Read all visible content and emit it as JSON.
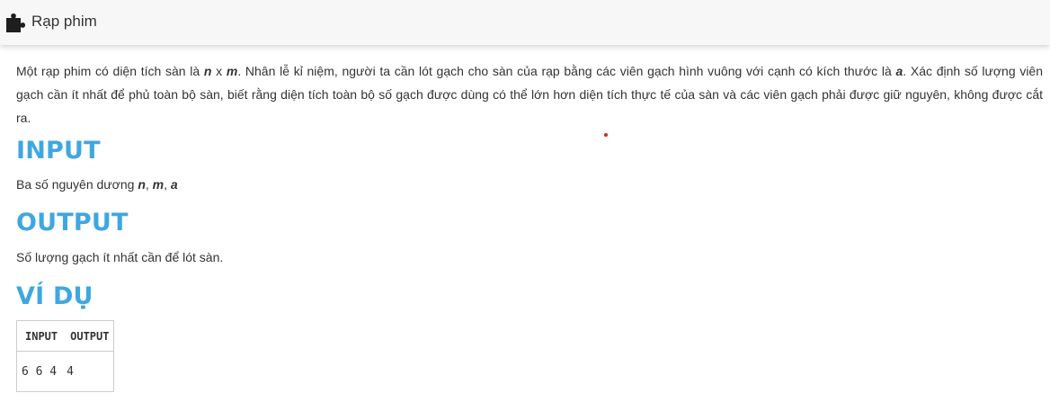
{
  "header": {
    "logo_icon": "puzzle-piece-icon",
    "title": "Rạp phim"
  },
  "problem": {
    "description_parts": [
      "Một rạp phim có diện tích sàn là ",
      "n",
      " x ",
      "m",
      ". Nhân lễ kỉ niệm, người ta cần lót gạch cho sàn của rạp bằng các viên gạch hình vuông với cạnh có kích thước là ",
      "a",
      ". Xác định số lượng viên gạch cần ít nhất để phủ toàn bộ sàn, biết rằng diện tích toàn bộ số gạch được dùng có thể lớn hơn diện tích thực tế của sàn và các viên gạch phải được giữ nguyên, không được cắt ra."
    ],
    "input_heading": "INPUT",
    "input_text": "Ba số nguyên dương ",
    "input_vars": [
      "n",
      "m",
      "a"
    ],
    "output_heading": "OUTPUT",
    "output_text": "Số lượng gạch ít nhất cần để lót sàn.",
    "example_heading": "VÍ DỤ",
    "example_table": {
      "headers": [
        "INPUT",
        "OUTPUT"
      ],
      "rows": [
        [
          "6 6 4",
          "4"
        ]
      ]
    }
  },
  "colors": {
    "heading": "#3fa7e0",
    "topbar_bg": "#f7f7f8",
    "marker": "#e0201d"
  }
}
